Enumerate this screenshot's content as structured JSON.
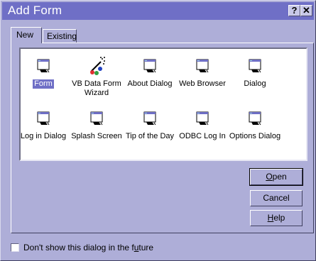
{
  "window": {
    "title": "Add Form",
    "help_button": "?",
    "close_button": "✕"
  },
  "tabs": [
    {
      "label": "New",
      "selected": true
    },
    {
      "label": "Existing",
      "selected": false
    }
  ],
  "items": [
    {
      "label": "Form",
      "label2": "",
      "icon": "form-icon",
      "selected": true
    },
    {
      "label": "VB Data Form",
      "label2": "Wizard",
      "icon": "wizard-wand-icon",
      "selected": false
    },
    {
      "label": "About Dialog",
      "label2": "",
      "icon": "form-icon",
      "selected": false
    },
    {
      "label": "Web Browser",
      "label2": "",
      "icon": "form-icon",
      "selected": false
    },
    {
      "label": "Dialog",
      "label2": "",
      "icon": "form-icon",
      "selected": false
    },
    {
      "label": "Log in Dialog",
      "label2": "",
      "icon": "form-icon",
      "selected": false
    },
    {
      "label": "Splash Screen",
      "label2": "",
      "icon": "form-icon",
      "selected": false
    },
    {
      "label": "Tip of the Day",
      "label2": "",
      "icon": "form-icon",
      "selected": false
    },
    {
      "label": "ODBC Log In",
      "label2": "",
      "icon": "form-icon",
      "selected": false
    },
    {
      "label": "Options Dialog",
      "label2": "",
      "icon": "form-icon",
      "selected": false
    }
  ],
  "buttons": {
    "open": {
      "pre": "",
      "accel": "O",
      "post": "pen"
    },
    "cancel": "Cancel",
    "help": {
      "pre": "",
      "accel": "H",
      "post": "elp"
    }
  },
  "checkbox": {
    "checked": false,
    "pre": "Don't show this dialog in the f",
    "accel": "u",
    "post": "ture"
  },
  "colors": {
    "titlebar": "#6f6fc6",
    "face": "#aeaed8",
    "selection": "#6f6fc6"
  }
}
